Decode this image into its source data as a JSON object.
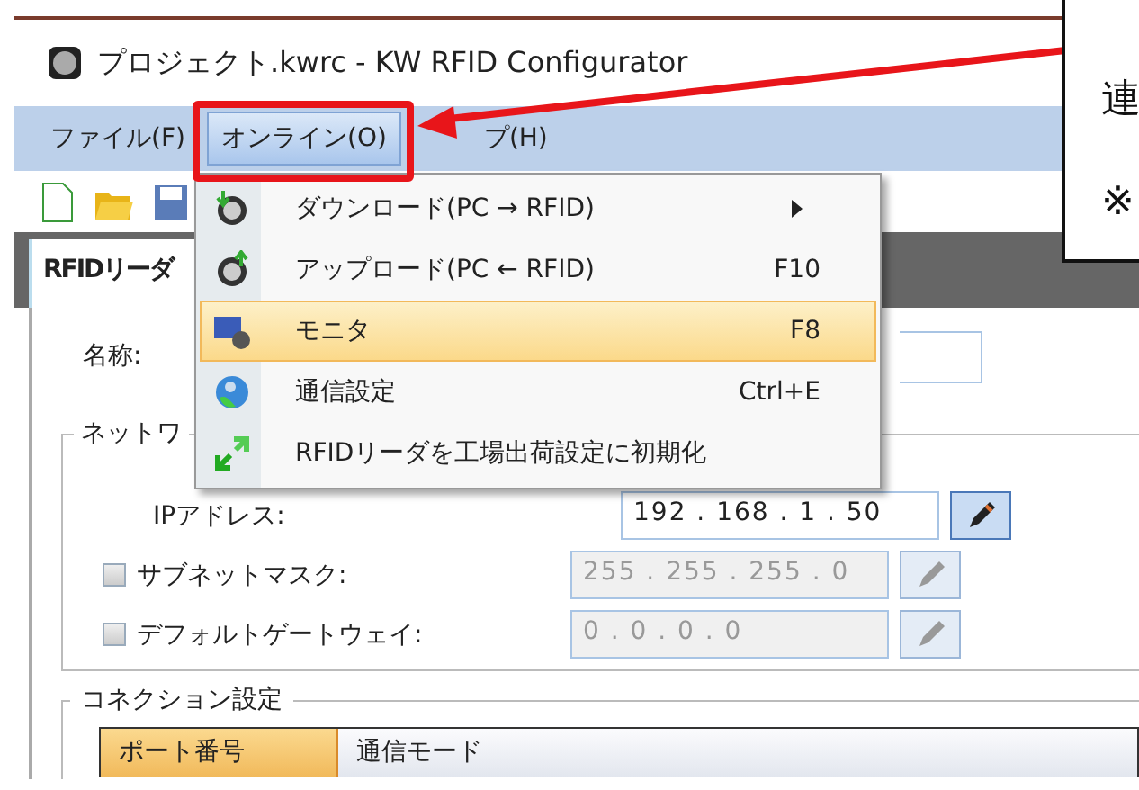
{
  "window": {
    "title": "プロジェクト.kwrc - KW RFID Configurator"
  },
  "menu_bar": [
    {
      "label": "ファイル(F)",
      "selected": false
    },
    {
      "label": "オンライン(O)",
      "selected": true
    },
    {
      "label": "プ(H)",
      "selected": false
    }
  ],
  "dropdown": [
    {
      "label": "ダウンロード(PC → RFID)",
      "submenu": true,
      "selected": false,
      "kind": "download"
    },
    {
      "label": "アップロード(PC ← RFID)",
      "shortcut": "F10",
      "submenu": false,
      "selected": false,
      "kind": "upload"
    },
    {
      "label": "モニタ",
      "shortcut": "F8",
      "submenu": false,
      "selected": true,
      "kind": "monitor"
    },
    {
      "label": "通信設定",
      "shortcut": "Ctrl+E",
      "submenu": false,
      "selected": false,
      "kind": "globe"
    },
    {
      "label": "RFIDリーダを工場出荷設定に初期化",
      "submenu": false,
      "selected": false,
      "kind": "reset"
    }
  ],
  "tab": {
    "label": "RFIDリーダ"
  },
  "form": {
    "name_label": "名称:",
    "network_group": "ネットワ",
    "network_rows": [
      {
        "kind": "plain",
        "label": "IPアドレス:",
        "value": "192 . 168 . 1 . 50",
        "disabled": false
      },
      {
        "kind": "checkbox",
        "label": "サブネットマスク:",
        "value": "255 . 255 . 255 . 0",
        "checked": false,
        "disabled": true
      },
      {
        "kind": "checkbox",
        "label": "デフォルトゲートウェイ:",
        "value": "0 . 0 . 0 . 0",
        "checked": false,
        "disabled": true
      }
    ]
  },
  "connection": {
    "title": "コネクション設定",
    "columns": [
      {
        "label": "ポート番号",
        "selected": true
      },
      {
        "label": "通信モード",
        "selected": false
      }
    ]
  },
  "callout": {
    "lines": [
      "連",
      "※"
    ]
  }
}
